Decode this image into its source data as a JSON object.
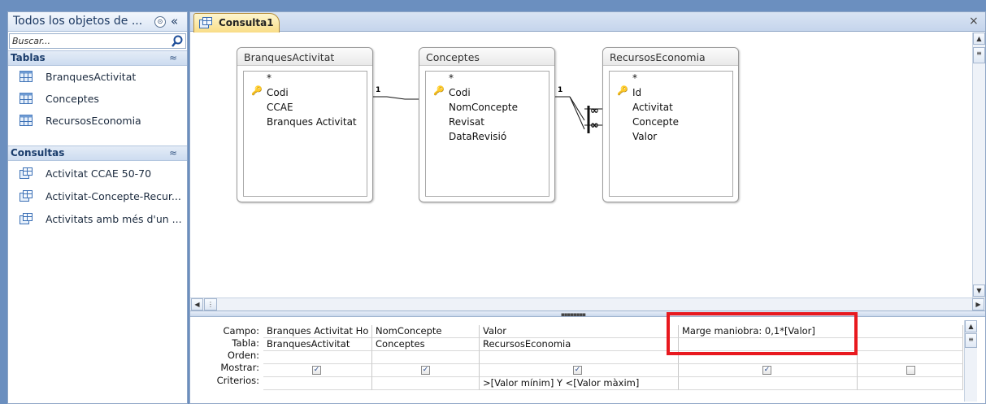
{
  "nav": {
    "title": "Todos los objetos de ...",
    "dropdown_glyph": "⊙",
    "collapse_glyph": "«",
    "search_placeholder": "Buscar...",
    "groups": [
      {
        "label": "Tablas",
        "items": [
          "BranquesActivitat",
          "Conceptes",
          "RecursosEconomia"
        ]
      },
      {
        "label": "Consultas",
        "items": [
          "Activitat CCAE 50-70",
          "Activitat-Concepte-Recur...",
          "Activitats amb més d'un ..."
        ]
      }
    ],
    "group_chevron": "≈"
  },
  "document": {
    "tab_label": "Consulta1",
    "close_glyph": "×"
  },
  "tables": [
    {
      "name": "BranquesActivitat",
      "fields": [
        "*",
        "Codi",
        "CCAE",
        "Branques Activitat"
      ],
      "key_field": "Codi"
    },
    {
      "name": "Conceptes",
      "fields": [
        "*",
        "Codi",
        "NomConcepte",
        "Revisat",
        "DataRevisió"
      ],
      "key_field": "Codi"
    },
    {
      "name": "RecursosEconomia",
      "fields": [
        "*",
        "Id",
        "Activitat",
        "Concepte",
        "Valor"
      ],
      "key_field": "Id"
    }
  ],
  "joins": {
    "one_label": "1",
    "many_label": "∞"
  },
  "grid": {
    "row_labels": [
      "Campo:",
      "Tabla:",
      "Orden:",
      "Mostrar:",
      "Criterios:"
    ],
    "columns": [
      {
        "campo": "Branques Activitat Ho",
        "tabla": "BranquesActivitat",
        "orden": "",
        "mostrar": true,
        "criterios": ""
      },
      {
        "campo": "NomConcepte",
        "tabla": "Conceptes",
        "orden": "",
        "mostrar": true,
        "criterios": ""
      },
      {
        "campo": "Valor",
        "tabla": "RecursosEconomia",
        "orden": "",
        "mostrar": true,
        "criterios": ">[Valor mínim] Y <[Valor màxim]"
      },
      {
        "campo": "Marge maniobra: 0,1*[Valor]",
        "tabla": "",
        "orden": "",
        "mostrar": true,
        "criterios": ""
      },
      {
        "campo": "",
        "tabla": "",
        "orden": "",
        "mostrar": false,
        "criterios": ""
      }
    ]
  },
  "colors": {
    "highlight": "#e8191f",
    "tab_accent": "#f9dd87",
    "nav_header": "#dbe6f5"
  }
}
